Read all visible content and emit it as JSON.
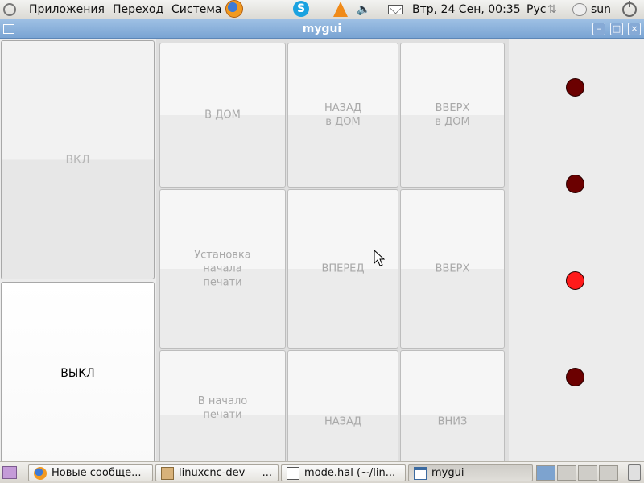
{
  "top_panel": {
    "menu_applications": "Приложения",
    "menu_places": "Переход",
    "menu_system": "Система",
    "clock": "Втр, 24 Сен, 00:35",
    "keyboard_layout": "Рус",
    "username": "sun"
  },
  "window": {
    "title": "mygui",
    "minimize_glyph": "–",
    "maximize_glyph": "□",
    "close_glyph": "×"
  },
  "left_buttons": {
    "on_label": "ВКЛ",
    "off_label": "ВЫКЛ"
  },
  "grid_buttons": [
    {
      "label": "В ДОМ"
    },
    {
      "label": "НАЗАД\nв  ДОМ"
    },
    {
      "label": "ВВЕРХ\nв ДОМ"
    },
    {
      "label": "Установка\nначала\nпечати"
    },
    {
      "label": "ВПЕРЕД"
    },
    {
      "label": "ВВЕРХ"
    },
    {
      "label": "В начало\nпечати"
    },
    {
      "label": "НАЗАД"
    },
    {
      "label": "ВНИЗ"
    }
  ],
  "indicators": [
    {
      "state": "off",
      "color": "#6b0000"
    },
    {
      "state": "off",
      "color": "#6b0000"
    },
    {
      "state": "on",
      "color": "#ff1a1a"
    },
    {
      "state": "off",
      "color": "#6b0000"
    }
  ],
  "taskbar": {
    "tasks": [
      {
        "label": "Новые сообще...",
        "icon": "firefox-icon"
      },
      {
        "label": "linuxcnc-dev — ...",
        "icon": "folder-icon"
      },
      {
        "label": "mode.hal (~/lin...",
        "icon": "text-editor-icon"
      },
      {
        "label": "mygui",
        "icon": "window-icon",
        "active": true
      }
    ]
  },
  "colors": {
    "titlebar": "#8ab2dc",
    "led_off": "#6b0000",
    "led_on": "#ff1a1a"
  }
}
